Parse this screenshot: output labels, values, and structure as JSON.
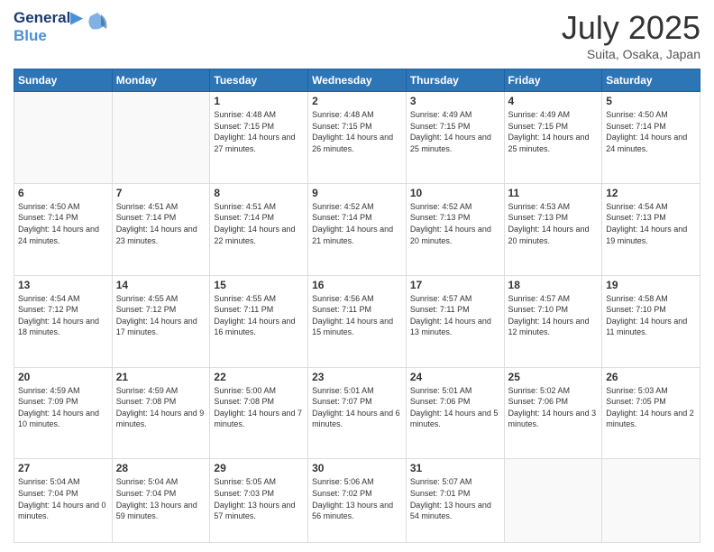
{
  "header": {
    "logo_line1": "General",
    "logo_line2": "Blue",
    "month_title": "July 2025",
    "location": "Suita, Osaka, Japan"
  },
  "weekdays": [
    "Sunday",
    "Monday",
    "Tuesday",
    "Wednesday",
    "Thursday",
    "Friday",
    "Saturday"
  ],
  "weeks": [
    [
      {
        "day": "",
        "info": ""
      },
      {
        "day": "",
        "info": ""
      },
      {
        "day": "1",
        "info": "Sunrise: 4:48 AM\nSunset: 7:15 PM\nDaylight: 14 hours and 27 minutes."
      },
      {
        "day": "2",
        "info": "Sunrise: 4:48 AM\nSunset: 7:15 PM\nDaylight: 14 hours and 26 minutes."
      },
      {
        "day": "3",
        "info": "Sunrise: 4:49 AM\nSunset: 7:15 PM\nDaylight: 14 hours and 25 minutes."
      },
      {
        "day": "4",
        "info": "Sunrise: 4:49 AM\nSunset: 7:15 PM\nDaylight: 14 hours and 25 minutes."
      },
      {
        "day": "5",
        "info": "Sunrise: 4:50 AM\nSunset: 7:14 PM\nDaylight: 14 hours and 24 minutes."
      }
    ],
    [
      {
        "day": "6",
        "info": "Sunrise: 4:50 AM\nSunset: 7:14 PM\nDaylight: 14 hours and 24 minutes."
      },
      {
        "day": "7",
        "info": "Sunrise: 4:51 AM\nSunset: 7:14 PM\nDaylight: 14 hours and 23 minutes."
      },
      {
        "day": "8",
        "info": "Sunrise: 4:51 AM\nSunset: 7:14 PM\nDaylight: 14 hours and 22 minutes."
      },
      {
        "day": "9",
        "info": "Sunrise: 4:52 AM\nSunset: 7:14 PM\nDaylight: 14 hours and 21 minutes."
      },
      {
        "day": "10",
        "info": "Sunrise: 4:52 AM\nSunset: 7:13 PM\nDaylight: 14 hours and 20 minutes."
      },
      {
        "day": "11",
        "info": "Sunrise: 4:53 AM\nSunset: 7:13 PM\nDaylight: 14 hours and 20 minutes."
      },
      {
        "day": "12",
        "info": "Sunrise: 4:54 AM\nSunset: 7:13 PM\nDaylight: 14 hours and 19 minutes."
      }
    ],
    [
      {
        "day": "13",
        "info": "Sunrise: 4:54 AM\nSunset: 7:12 PM\nDaylight: 14 hours and 18 minutes."
      },
      {
        "day": "14",
        "info": "Sunrise: 4:55 AM\nSunset: 7:12 PM\nDaylight: 14 hours and 17 minutes."
      },
      {
        "day": "15",
        "info": "Sunrise: 4:55 AM\nSunset: 7:11 PM\nDaylight: 14 hours and 16 minutes."
      },
      {
        "day": "16",
        "info": "Sunrise: 4:56 AM\nSunset: 7:11 PM\nDaylight: 14 hours and 15 minutes."
      },
      {
        "day": "17",
        "info": "Sunrise: 4:57 AM\nSunset: 7:11 PM\nDaylight: 14 hours and 13 minutes."
      },
      {
        "day": "18",
        "info": "Sunrise: 4:57 AM\nSunset: 7:10 PM\nDaylight: 14 hours and 12 minutes."
      },
      {
        "day": "19",
        "info": "Sunrise: 4:58 AM\nSunset: 7:10 PM\nDaylight: 14 hours and 11 minutes."
      }
    ],
    [
      {
        "day": "20",
        "info": "Sunrise: 4:59 AM\nSunset: 7:09 PM\nDaylight: 14 hours and 10 minutes."
      },
      {
        "day": "21",
        "info": "Sunrise: 4:59 AM\nSunset: 7:08 PM\nDaylight: 14 hours and 9 minutes."
      },
      {
        "day": "22",
        "info": "Sunrise: 5:00 AM\nSunset: 7:08 PM\nDaylight: 14 hours and 7 minutes."
      },
      {
        "day": "23",
        "info": "Sunrise: 5:01 AM\nSunset: 7:07 PM\nDaylight: 14 hours and 6 minutes."
      },
      {
        "day": "24",
        "info": "Sunrise: 5:01 AM\nSunset: 7:06 PM\nDaylight: 14 hours and 5 minutes."
      },
      {
        "day": "25",
        "info": "Sunrise: 5:02 AM\nSunset: 7:06 PM\nDaylight: 14 hours and 3 minutes."
      },
      {
        "day": "26",
        "info": "Sunrise: 5:03 AM\nSunset: 7:05 PM\nDaylight: 14 hours and 2 minutes."
      }
    ],
    [
      {
        "day": "27",
        "info": "Sunrise: 5:04 AM\nSunset: 7:04 PM\nDaylight: 14 hours and 0 minutes."
      },
      {
        "day": "28",
        "info": "Sunrise: 5:04 AM\nSunset: 7:04 PM\nDaylight: 13 hours and 59 minutes."
      },
      {
        "day": "29",
        "info": "Sunrise: 5:05 AM\nSunset: 7:03 PM\nDaylight: 13 hours and 57 minutes."
      },
      {
        "day": "30",
        "info": "Sunrise: 5:06 AM\nSunset: 7:02 PM\nDaylight: 13 hours and 56 minutes."
      },
      {
        "day": "31",
        "info": "Sunrise: 5:07 AM\nSunset: 7:01 PM\nDaylight: 13 hours and 54 minutes."
      },
      {
        "day": "",
        "info": ""
      },
      {
        "day": "",
        "info": ""
      }
    ]
  ]
}
